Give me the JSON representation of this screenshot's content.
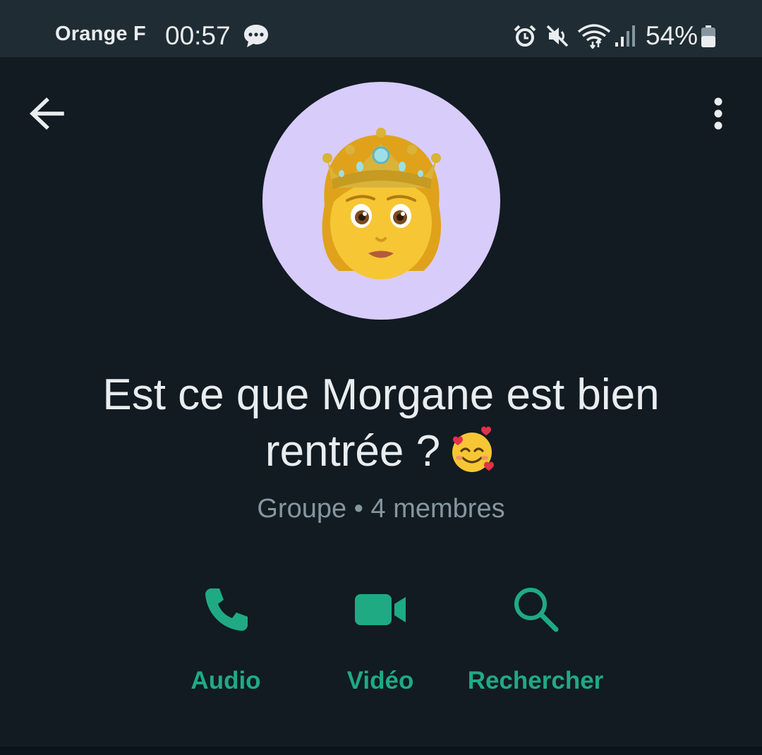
{
  "status_bar": {
    "carrier": "Orange F",
    "time": "00:57",
    "battery_percent": "54%",
    "icons": [
      "chat-bubble-icon",
      "alarm-icon",
      "mute-icon",
      "wifi-icon",
      "signal-icon",
      "battery-icon"
    ]
  },
  "header": {
    "back_icon": "arrow-left-icon",
    "menu_icon": "more-vertical-icon"
  },
  "group": {
    "avatar_icon": "princess-emoji",
    "title_line1": "Est ce que Morgane est bien",
    "title_line2": "rentrée ?",
    "title_emoji": "smiling-face-with-hearts-emoji",
    "subtitle": "Groupe • 4 membres"
  },
  "actions": [
    {
      "label": "Audio",
      "icon": "phone-icon"
    },
    {
      "label": "Vidéo",
      "icon": "video-camera-icon"
    },
    {
      "label": "Rechercher",
      "icon": "search-icon"
    }
  ],
  "colors": {
    "background": "#111b21",
    "status_bar": "#202c33",
    "accent": "#1faa84",
    "avatar_bg": "#d8ccfb",
    "title_text": "#e9edef",
    "subtitle_text": "#8696a0"
  }
}
